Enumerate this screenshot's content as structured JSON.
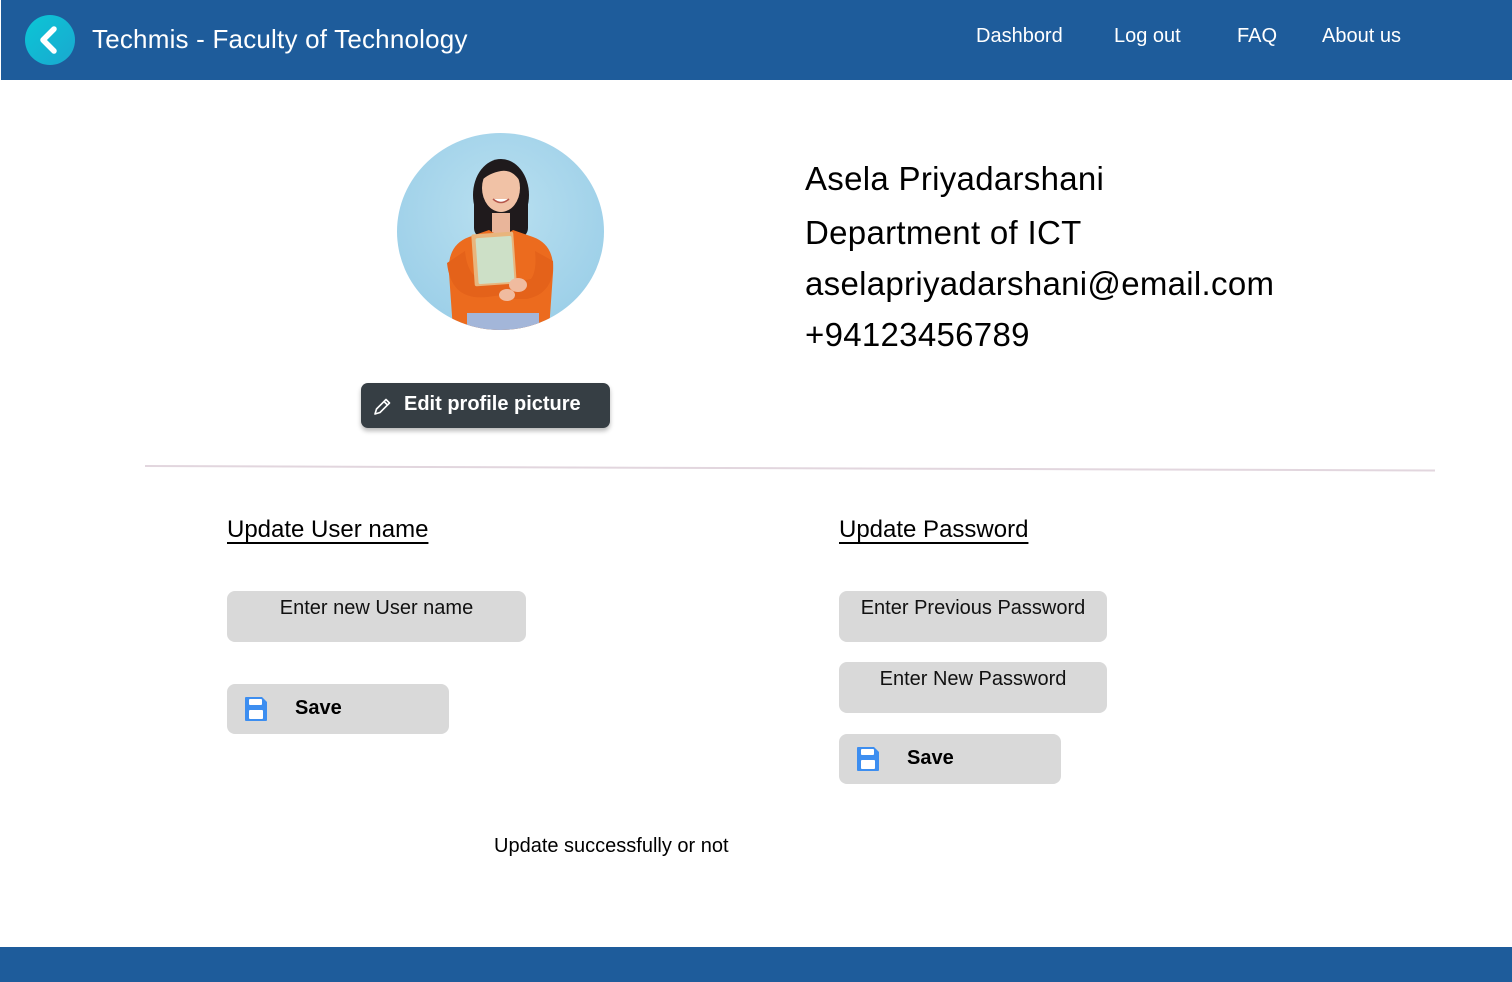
{
  "header": {
    "title": "Techmis - Faculty of Technology",
    "back_icon": "chevron-left-icon",
    "nav": {
      "dashboard": "Dashbord",
      "logout": "Log out",
      "faq": "FAQ",
      "about": "About us"
    }
  },
  "profile": {
    "name": "Asela Priyadarshani",
    "department": "Department of ICT",
    "email": "aselapriyadarshani@email.com",
    "phone": "+94123456789",
    "edit_picture_label": "Edit profile picture",
    "edit_icon": "pencil-icon"
  },
  "username_section": {
    "heading": "Update User name",
    "input_placeholder": "Enter new User name",
    "save_label": "Save",
    "save_icon": "floppy-disk-icon"
  },
  "password_section": {
    "heading": "Update Password",
    "previous_placeholder": "Enter Previous Password",
    "new_placeholder": "Enter New Password",
    "save_label": "Save",
    "save_icon": "floppy-disk-icon"
  },
  "status": {
    "message": "Update successfully or not"
  },
  "colors": {
    "header_bg": "#1e5c9b",
    "back_button": "#0bc6d6",
    "edit_button_bg": "#363e44",
    "field_bg": "#d9d9d9",
    "save_icon": "#3d8ef0",
    "footer_bg": "#1e5c9b"
  }
}
